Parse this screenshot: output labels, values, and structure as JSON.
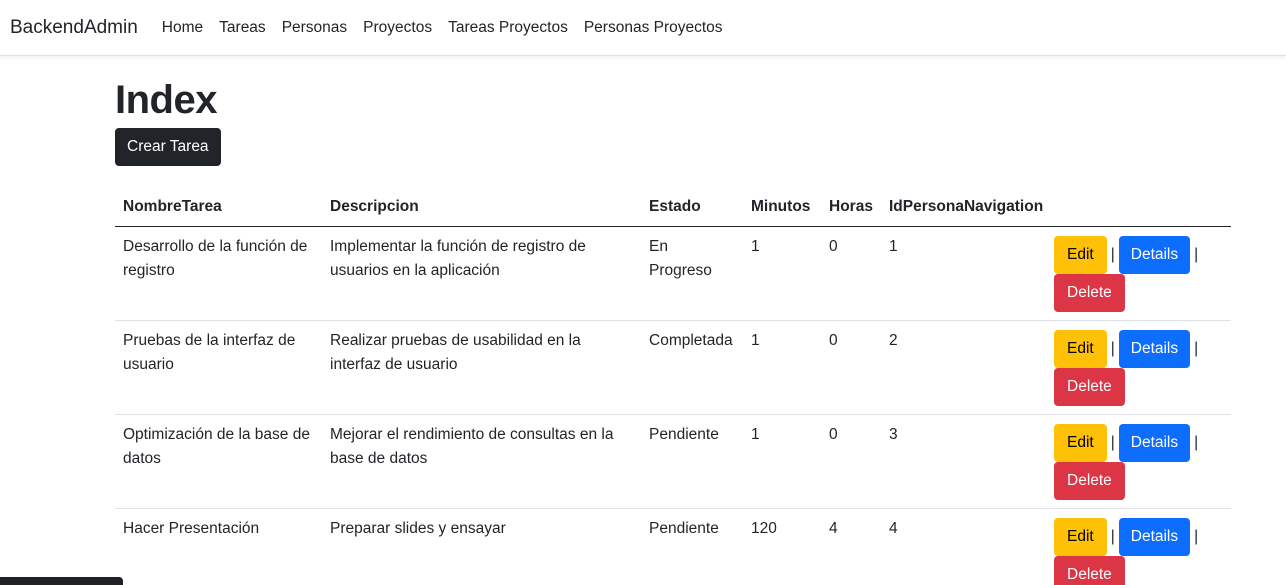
{
  "navbar": {
    "brand": "BackendAdmin",
    "links": [
      "Home",
      "Tareas",
      "Personas",
      "Proyectos",
      "Tareas Proyectos",
      "Personas Proyectos"
    ]
  },
  "page": {
    "title": "Index",
    "create_label": "Crear Tarea"
  },
  "table": {
    "headers": {
      "nombre": "NombreTarea",
      "descripcion": "Descripcion",
      "estado": "Estado",
      "minutos": "Minutos",
      "horas": "Horas",
      "persona": "IdPersonaNavigation"
    },
    "rows": [
      {
        "nombre": "Desarrollo de la función de registro",
        "descripcion": "Implementar la función de registro de usuarios en la aplicación",
        "estado": "En Progreso",
        "minutos": "1",
        "horas": "0",
        "persona": "1"
      },
      {
        "nombre": "Pruebas de la interfaz de usuario",
        "descripcion": "Realizar pruebas de usabilidad en la interfaz de usuario",
        "estado": "Completada",
        "minutos": "1",
        "horas": "0",
        "persona": "2"
      },
      {
        "nombre": "Optimización de la base de datos",
        "descripcion": "Mejorar el rendimiento de consultas en la base de datos",
        "estado": "Pendiente",
        "minutos": "1",
        "horas": "0",
        "persona": "3"
      },
      {
        "nombre": "Hacer Presentación",
        "descripcion": "Preparar slides y ensayar",
        "estado": "Pendiente",
        "minutos": "120",
        "horas": "4",
        "persona": "4"
      }
    ],
    "actions": {
      "edit": "Edit",
      "details": "Details",
      "delete": "Delete",
      "separator": "|"
    }
  },
  "colors": {
    "edit": "#ffc107",
    "details": "#0d6efd",
    "delete": "#dc3545",
    "dark": "#212529"
  }
}
